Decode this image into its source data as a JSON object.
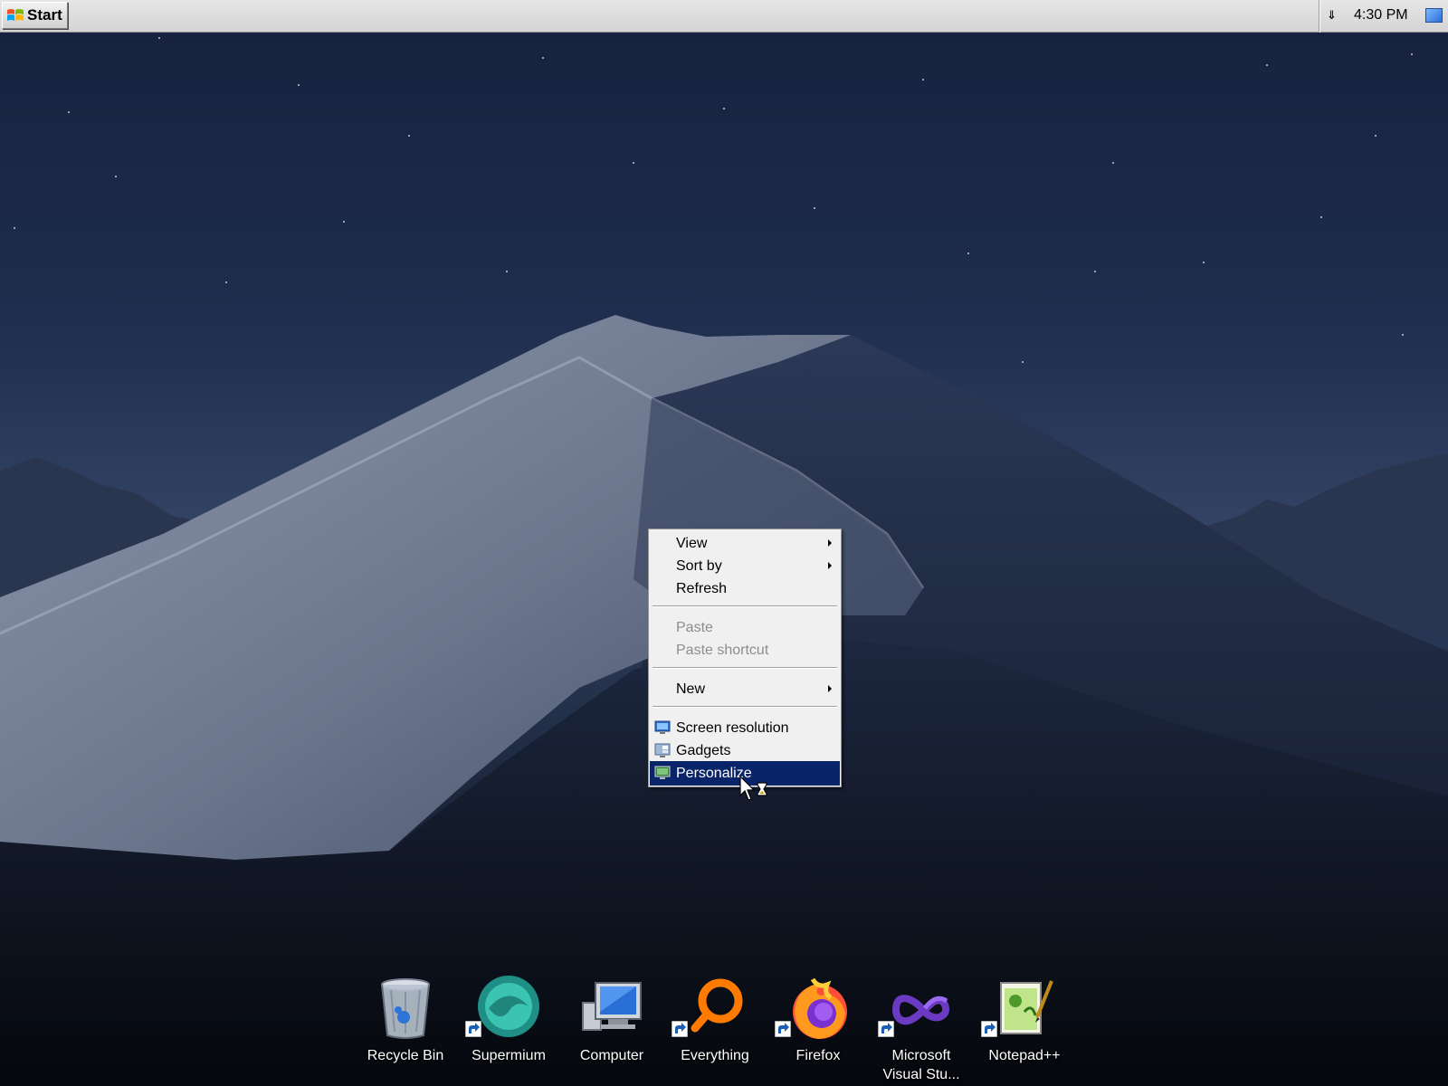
{
  "taskbar": {
    "start_label": "Start",
    "clock": "4:30 PM",
    "tray_chevron_icon": "chevron-double-down-icon",
    "show_desktop_icon": "show-desktop-icon"
  },
  "context_menu": {
    "items": [
      {
        "label": "View",
        "has_submenu": true,
        "enabled": true
      },
      {
        "label": "Sort by",
        "has_submenu": true,
        "enabled": true
      },
      {
        "label": "Refresh",
        "has_submenu": false,
        "enabled": true
      },
      {
        "label": "Paste",
        "has_submenu": false,
        "enabled": false
      },
      {
        "label": "Paste shortcut",
        "has_submenu": false,
        "enabled": false
      },
      {
        "label": "New",
        "has_submenu": true,
        "enabled": true
      },
      {
        "label": "Screen resolution",
        "icon": "screen-resolution-icon",
        "enabled": true
      },
      {
        "label": "Gadgets",
        "icon": "gadgets-icon",
        "enabled": true
      },
      {
        "label": "Personalize",
        "icon": "personalize-icon",
        "enabled": true,
        "highlighted": true
      }
    ],
    "highlight_color": "#0a246a"
  },
  "desktop_icons": [
    {
      "label": "Recycle Bin",
      "icon": "recycle-bin-icon",
      "shortcut": false
    },
    {
      "label": "Supermium",
      "icon": "supermium-icon",
      "shortcut": true
    },
    {
      "label": "Computer",
      "icon": "computer-icon",
      "shortcut": false
    },
    {
      "label": "Everything",
      "icon": "everything-icon",
      "shortcut": true
    },
    {
      "label": "Firefox",
      "icon": "firefox-icon",
      "shortcut": true
    },
    {
      "label": "Microsoft\nVisual Stu...",
      "icon": "visual-studio-icon",
      "shortcut": true
    },
    {
      "label": "Notepad++",
      "icon": "notepad-plus-plus-icon",
      "shortcut": true
    }
  ],
  "cursor": "arrow-busy-cursor"
}
